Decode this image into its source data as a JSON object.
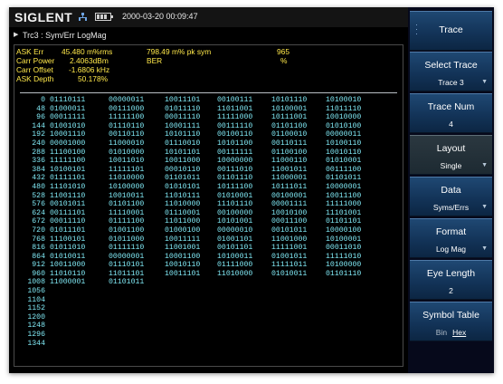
{
  "header": {
    "brand": "SIGLENT",
    "datetime": "2000-03-20 00:09:47"
  },
  "trace_info": "Trc3 : Sym/Err LogMag",
  "measurements": {
    "left_labels": [
      "ASK Err",
      "Carr Power",
      "Carr Offset",
      "ASK Depth"
    ],
    "left_values": [
      "45.480 m%rms",
      "2.4063dBm",
      "-1.6806 kHz",
      "50.178%"
    ],
    "mid_items": [
      {
        "text": "798.49 m% pk sym",
        "value": "965"
      },
      {
        "text": "BER",
        "value": "%"
      }
    ]
  },
  "symbols": {
    "indices": [
      0,
      48,
      96,
      144,
      192,
      240,
      288,
      336,
      384,
      432,
      480,
      528,
      576,
      624,
      672,
      720,
      768,
      816,
      864,
      912,
      960,
      1008,
      1056,
      1104,
      1152,
      1200,
      1248,
      1296,
      1344
    ],
    "rows": [
      [
        "01110111",
        "00000011",
        "10011101",
        "00100111",
        "10101110",
        "10100010"
      ],
      [
        "01000011",
        "00111000",
        "01011110",
        "11011001",
        "10100001",
        "11011110"
      ],
      [
        "00011111",
        "11111100",
        "00011110",
        "11111000",
        "10111001",
        "10010000"
      ],
      [
        "01001010",
        "01110110",
        "10001111",
        "00111110",
        "01101100",
        "01010100"
      ],
      [
        "10001110",
        "00110110",
        "10101110",
        "00100110",
        "01100010",
        "00000011"
      ],
      [
        "00001000",
        "11000010",
        "01110010",
        "10101100",
        "00110111",
        "10100110"
      ],
      [
        "11100100",
        "01010000",
        "10101101",
        "00111111",
        "01100100",
        "10010110"
      ],
      [
        "11111100",
        "10011010",
        "10011000",
        "10000000",
        "11000110",
        "01010001"
      ],
      [
        "10100101",
        "11111101",
        "00010110",
        "00111010",
        "11001011",
        "00111100"
      ],
      [
        "01111101",
        "11010000",
        "01101011",
        "01101110",
        "11000001",
        "01101011"
      ],
      [
        "11101010",
        "10100000",
        "01010101",
        "10111100",
        "10111011",
        "10000001"
      ],
      [
        "11001110",
        "10010011",
        "11010111",
        "01010001",
        "00100001",
        "10011100"
      ],
      [
        "00101011",
        "01101100",
        "11010000",
        "11101110",
        "00001111",
        "11111000"
      ],
      [
        "00111101",
        "11110001",
        "01110001",
        "00100000",
        "10010100",
        "11101001"
      ],
      [
        "00011110",
        "01111100",
        "11011000",
        "10101001",
        "00011100",
        "01101101"
      ],
      [
        "01011101",
        "01001100",
        "01000100",
        "00000010",
        "00101011",
        "10000100"
      ],
      [
        "11100101",
        "01011000",
        "10011111",
        "01001101",
        "11001000",
        "10100001"
      ],
      [
        "01011010",
        "01111110",
        "11001001",
        "00101101",
        "11111001",
        "00011010"
      ],
      [
        "01010011",
        "00000001",
        "10001100",
        "10100011",
        "01001011",
        "11111010"
      ],
      [
        "10011000",
        "01110101",
        "10010110",
        "01111000",
        "11111011",
        "10100000"
      ],
      [
        "11010110",
        "11011101",
        "10011101",
        "11010000",
        "01010011",
        "01101110"
      ],
      [
        "11000001",
        "01101011"
      ],
      [],
      [],
      [],
      [],
      [],
      [],
      []
    ]
  },
  "menu": {
    "title": "Trace",
    "items": [
      {
        "label": "Select Trace",
        "value": "Trace 3"
      },
      {
        "label": "Trace Num",
        "value": "4"
      },
      {
        "label": "Layout",
        "value": "Single"
      },
      {
        "label": "Data",
        "value": "Syms/Errs"
      },
      {
        "label": "Format",
        "value": "Log Mag"
      },
      {
        "label": "Eye Length",
        "value": "2"
      },
      {
        "label": "Symbol Table",
        "opt_a": "Bin",
        "opt_b": "Hex"
      }
    ]
  },
  "colors": {
    "measure": "#ffe84a",
    "symbols": "#7fe7f3",
    "menu": "#143a63",
    "highlight": "#25323a"
  }
}
